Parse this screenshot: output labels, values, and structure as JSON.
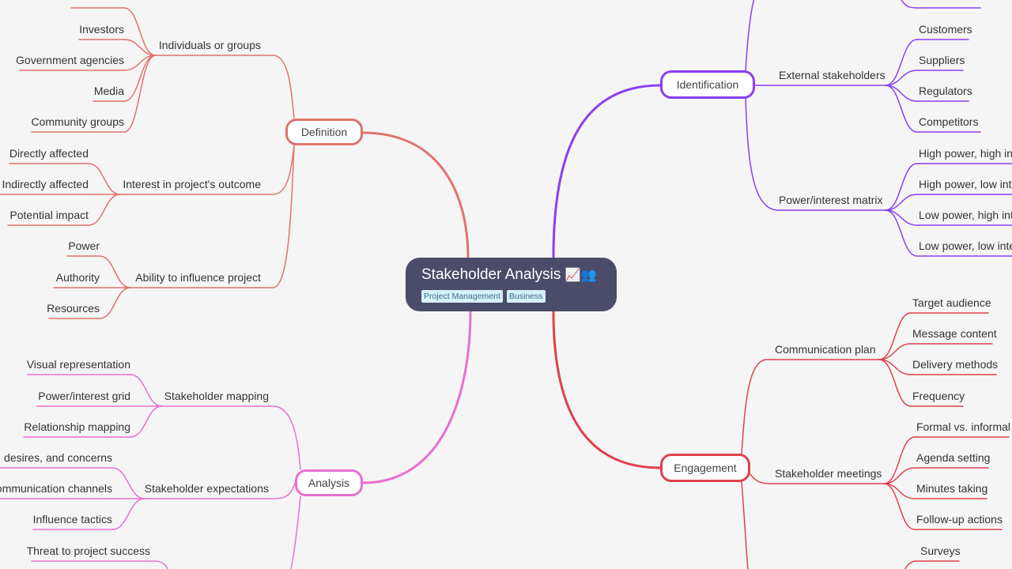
{
  "root": {
    "title": "Stakeholder Analysis",
    "emoji": "📈👥",
    "tags": [
      "Project Management",
      "Business"
    ]
  },
  "colors": {
    "definition": "#e0726f",
    "identification": "#8a3ff0",
    "analysis": "#e870d0",
    "engagement": "#e0404e",
    "root_bg": "#4b4c6a",
    "background": "#f5f5f5"
  },
  "branches": {
    "definition": {
      "label": "Definition",
      "children": [
        {
          "label": "Individuals or groups",
          "children": [
            "",
            "Investors",
            "Government agencies",
            "Media",
            "Community groups"
          ]
        },
        {
          "label": "Interest in project's outcome",
          "children": [
            "Directly affected",
            "Indirectly affected",
            "Potential impact"
          ]
        },
        {
          "label": "Ability to influence project",
          "children": [
            "Power",
            "Authority",
            "Resources"
          ]
        }
      ]
    },
    "identification": {
      "label": "Identification",
      "children": [
        {
          "label": "",
          "children": [
            ""
          ]
        },
        {
          "label": "External stakeholders",
          "children": [
            "Customers",
            "Suppliers",
            "Regulators",
            "Competitors"
          ]
        },
        {
          "label": "Power/interest matrix",
          "children": [
            "High power, high int",
            "High power, low inte",
            "Low power, high int",
            "Low power, low inte"
          ]
        }
      ]
    },
    "analysis": {
      "label": "Analysis",
      "children": [
        {
          "label": "Stakeholder mapping",
          "children": [
            "Visual representation",
            "Power/interest grid",
            "Relationship mapping"
          ]
        },
        {
          "label": "Stakeholder expectations",
          "children": [
            "s, desires, and concerns",
            "ommunication channels",
            "Influence tactics"
          ]
        },
        {
          "label": "",
          "children": [
            "Threat to project success"
          ]
        }
      ]
    },
    "engagement": {
      "label": "Engagement",
      "children": [
        {
          "label": "Communication plan",
          "children": [
            "Target audience",
            "Message content",
            "Delivery methods",
            "Frequency"
          ]
        },
        {
          "label": "Stakeholder meetings",
          "children": [
            "Formal vs. informal",
            "Agenda setting",
            "Minutes taking",
            "Follow-up actions"
          ]
        },
        {
          "label": "",
          "children": [
            "Surveys"
          ]
        }
      ]
    }
  }
}
